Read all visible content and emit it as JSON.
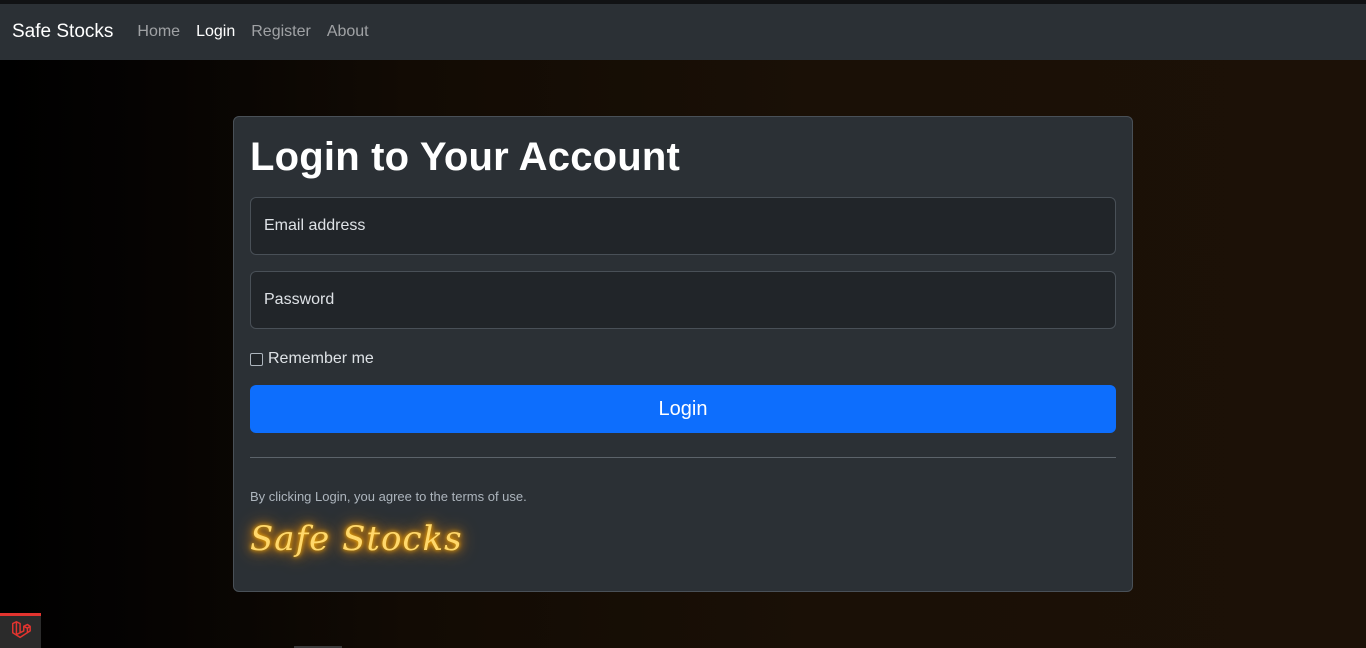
{
  "navbar": {
    "brand": "Safe Stocks",
    "links": [
      {
        "label": "Home",
        "active": false
      },
      {
        "label": "Login",
        "active": true
      },
      {
        "label": "Register",
        "active": false
      },
      {
        "label": "About",
        "active": false
      }
    ]
  },
  "login_form": {
    "title": "Login to Your Account",
    "email_placeholder": "Email address",
    "password_placeholder": "Password",
    "remember_label": "Remember me",
    "submit_label": "Login",
    "terms_text": "By clicking Login, you agree to the terms of use.",
    "logo_text": "Safe Stocks"
  },
  "colors": {
    "navbar_bg": "#2b3035",
    "card_bg": "#2b3035",
    "input_bg": "#212529",
    "primary": "#0d6efd",
    "logo_glow": "#ffb300",
    "debug_accent": "#e3342f"
  },
  "icons": {
    "debug_badge": "laravel-icon"
  }
}
